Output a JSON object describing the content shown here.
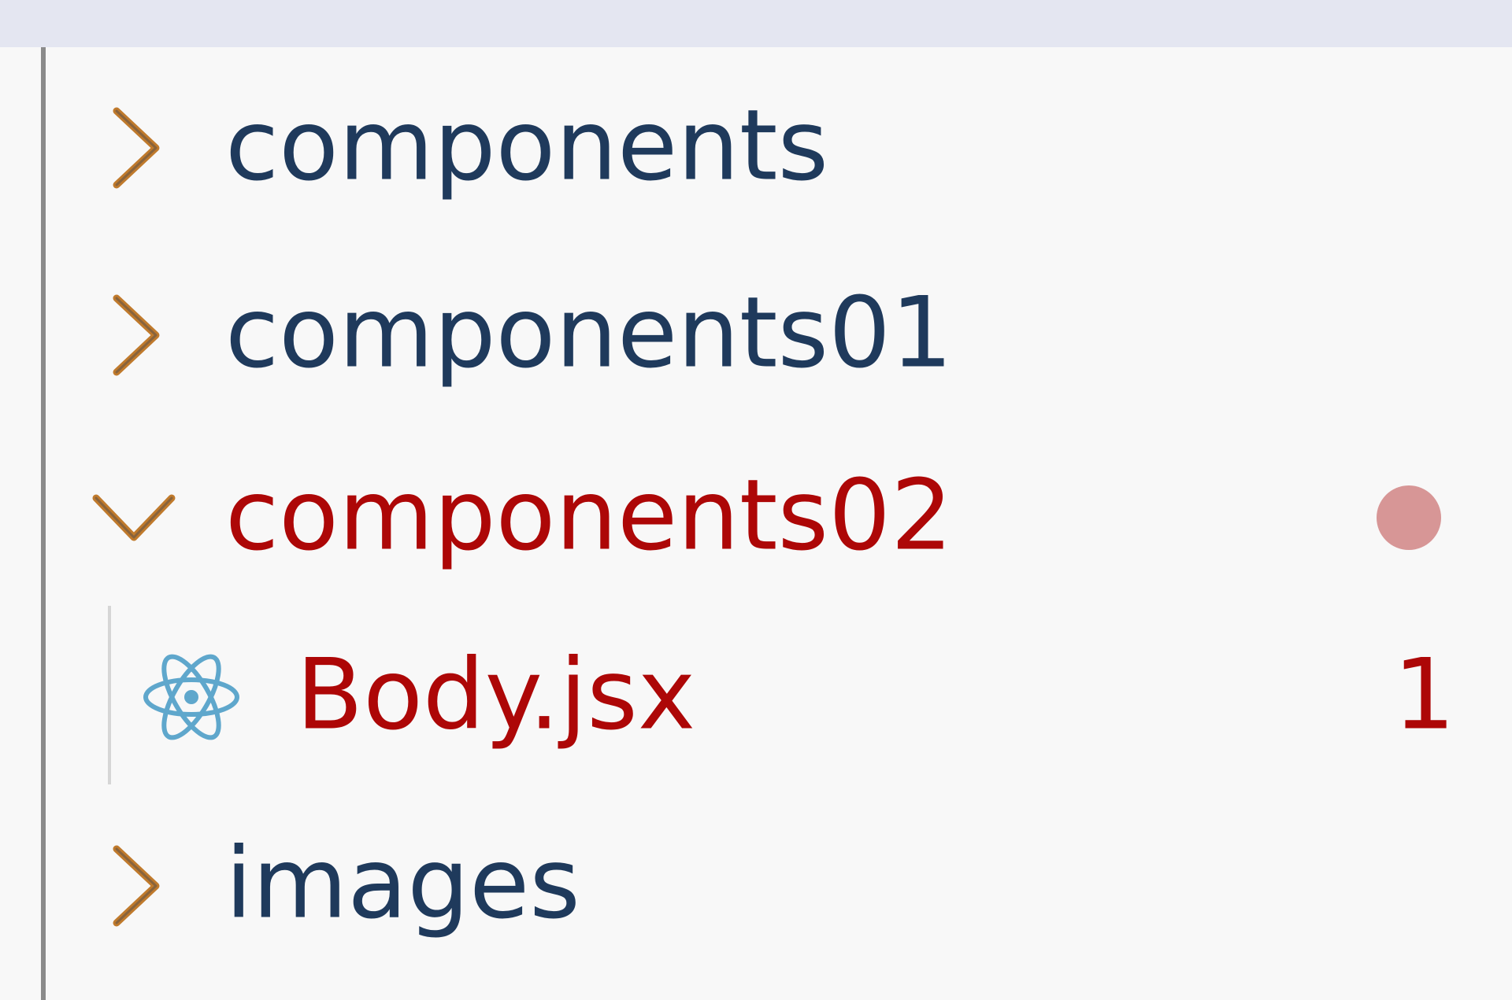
{
  "explorer": {
    "items": [
      {
        "label": "components",
        "expanded": false
      },
      {
        "label": "components01",
        "expanded": false
      },
      {
        "label": "components02",
        "expanded": true,
        "status": "error"
      },
      {
        "label": "Body.jsx",
        "icon": "react-icon",
        "problems": "1",
        "status": "error"
      },
      {
        "label": "images",
        "expanded": false
      }
    ]
  },
  "colors": {
    "background": "#f8f8f8",
    "top_strip": "#e4e6f1",
    "folder_text": "#1f3a5c",
    "error_text": "#ad0707",
    "chevron": "#c07a2c",
    "error_dot": "#d79696",
    "react_icon": "#5fa7cc"
  }
}
